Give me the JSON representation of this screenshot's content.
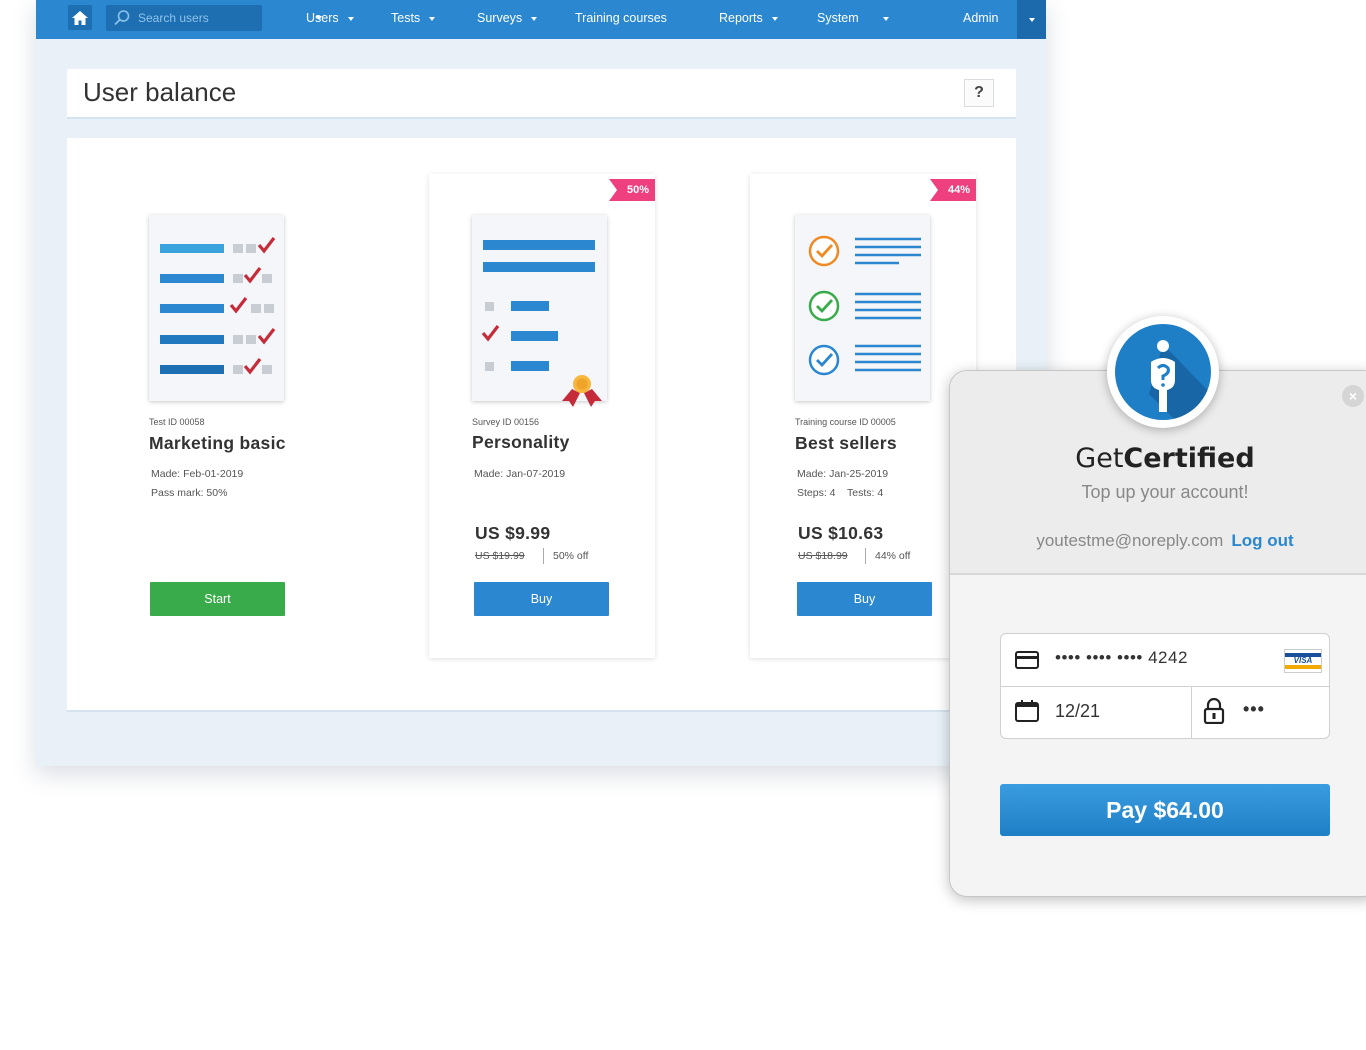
{
  "nav": {
    "search_placeholder": "Search users",
    "items": [
      "Users",
      "Tests",
      "Surveys",
      "Training courses",
      "Reports",
      "System"
    ],
    "admin": "Admin"
  },
  "page": {
    "title": "User balance",
    "help": "?"
  },
  "cards": [
    {
      "id_label": "Test ID 00058",
      "name": "Marketing basic",
      "meta1": "Made: Feb-01-2019",
      "meta2": "Pass mark: 50%",
      "button": "Start"
    },
    {
      "ribbon": "50%",
      "id_label": "Survey ID 00156",
      "name": "Personality",
      "meta1": "Made: Jan-07-2019",
      "price": "US $9.99",
      "old_price": "US $19.99",
      "discount": "50% off",
      "button": "Buy"
    },
    {
      "ribbon": "44%",
      "id_label": "Training course ID 00005",
      "name": "Best sellers",
      "meta1": "Made: Jan-25-2019",
      "meta2": "Steps: 4    Tests: 4",
      "price": "US $10.63",
      "old_price": "US $18.99",
      "discount": "44% off",
      "button": "Buy"
    }
  ],
  "payment": {
    "brand_light": "Get",
    "brand_bold": "Certified",
    "tagline": "Top up your account!",
    "email": "youtestme@noreply.com",
    "logout": "Log out",
    "card_number": "•••• •••• •••• 4242",
    "card_brand": "VISA",
    "expiry": "12/21",
    "cvc": "•••",
    "pay_button": "Pay $64.00",
    "close": "×"
  },
  "colors": {
    "nav_blue": "#2a87d0",
    "green": "#3aab4a",
    "ribbon_pink": "#ee3f7f",
    "check_red": "#c62b3a"
  }
}
